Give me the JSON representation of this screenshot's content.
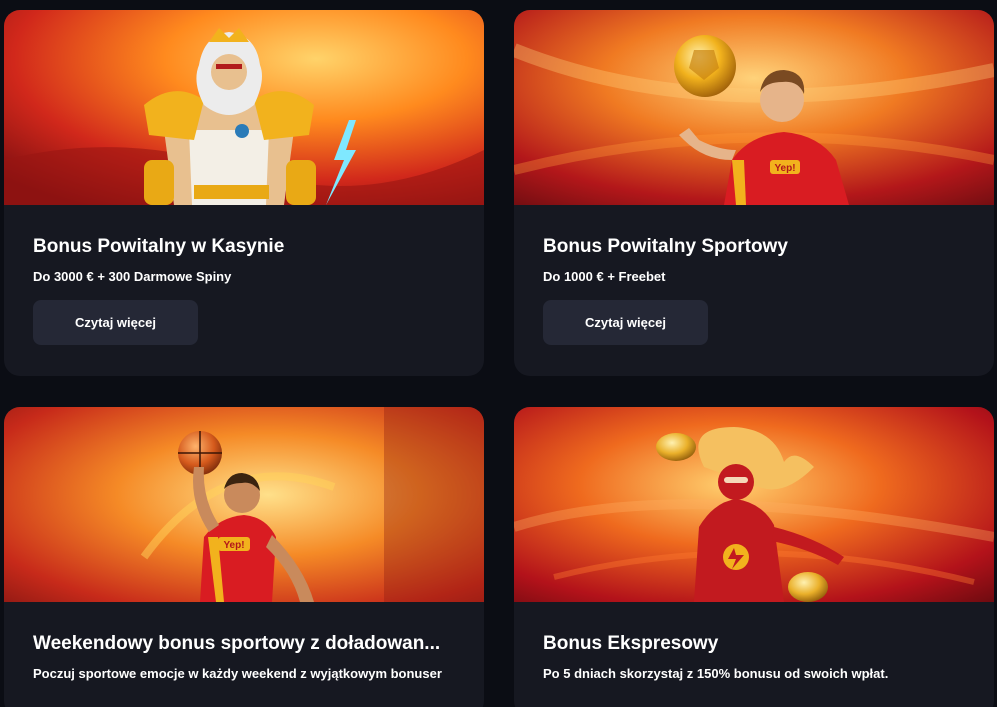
{
  "cards": [
    {
      "title": "Bonus Powitalny w Kasynie",
      "subtitle": "Do 3000 € + 300 Darmowe Spiny",
      "button": "Czytaj więcej",
      "image": "zeus-character-image"
    },
    {
      "title": "Bonus Powitalny Sportowy",
      "subtitle": "Do 1000 € + Freebet",
      "button": "Czytaj więcej",
      "image": "football-player-image",
      "jersey_logo": "Yep!"
    },
    {
      "title": "Weekendowy bonus sportowy z doładowan...",
      "subtitle": "Poczuj sportowe emocje w każdy weekend z wyjątkowym bonuser",
      "image": "basketball-player-image",
      "jersey_logo": "Yep!"
    },
    {
      "title": "Bonus Ekspresowy",
      "subtitle": "Po 5 dniach skorzystaj z 150% bonusu od swoich wpłat.",
      "image": "speedster-hero-image"
    }
  ],
  "colors": {
    "page_bg": "#0b0d14",
    "card_bg": "#161821",
    "button_bg": "#252836",
    "accent_orange": "#ff8a00",
    "accent_red": "#c8141e"
  }
}
